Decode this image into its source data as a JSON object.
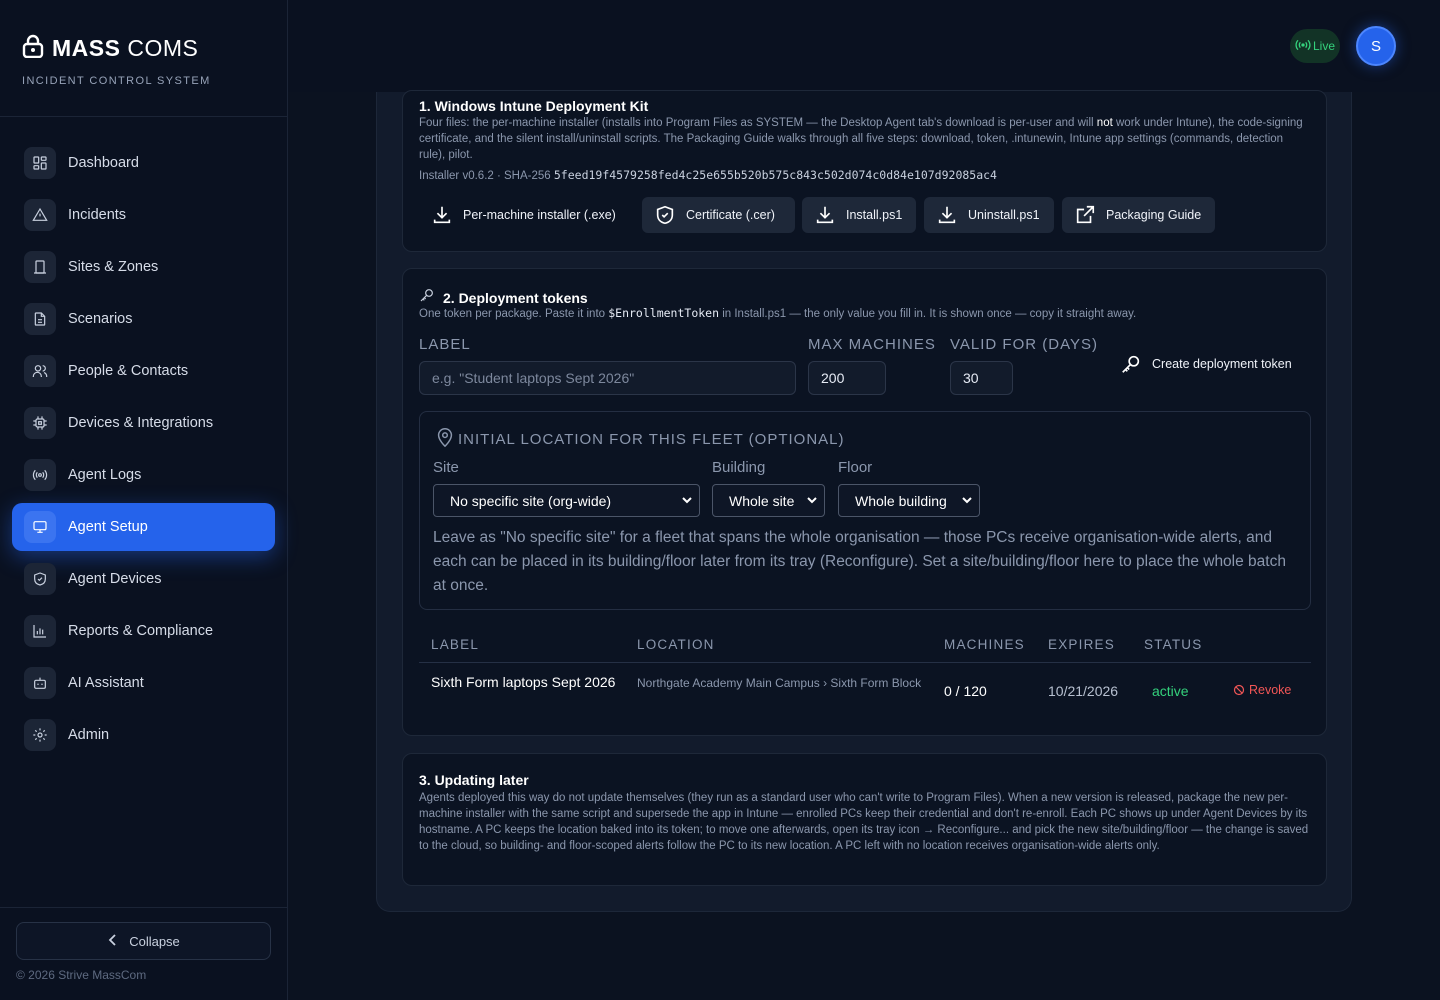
{
  "brand": {
    "name_bold": "MASS",
    "name_light": "COMS",
    "subtitle": "INCIDENT CONTROL SYSTEM"
  },
  "sidebar": {
    "items": [
      {
        "label": "Dashboard",
        "icon": "dashboard-icon"
      },
      {
        "label": "Incidents",
        "icon": "alert-triangle-icon"
      },
      {
        "label": "Sites & Zones",
        "icon": "building-icon"
      },
      {
        "label": "Scenarios",
        "icon": "document-icon"
      },
      {
        "label": "People & Contacts",
        "icon": "users-icon"
      },
      {
        "label": "Devices & Integrations",
        "icon": "chip-icon"
      },
      {
        "label": "Agent Logs",
        "icon": "broadcast-icon"
      },
      {
        "label": "Agent Setup",
        "icon": "monitor-icon",
        "active": true
      },
      {
        "label": "Agent Devices",
        "icon": "shield-icon"
      },
      {
        "label": "Reports & Compliance",
        "icon": "bar-chart-icon"
      },
      {
        "label": "AI Assistant",
        "icon": "bot-icon"
      },
      {
        "label": "Admin",
        "icon": "gear-icon"
      }
    ],
    "collapse_label": "Collapse",
    "copyright": "© 2026 Strive MassCom"
  },
  "topbar": {
    "live_label": "Live",
    "avatar_initial": "S",
    "accent": "#2563eb",
    "live_color": "#34d17c"
  },
  "kit": {
    "title": "1. Windows Intune Deployment Kit",
    "desc_a": "Four files: the per-machine installer (installs into Program Files as SYSTEM — the Desktop Agent tab's download is per-user and will ",
    "desc_bold": "not",
    "desc_b": " work under Intune), the code-signing certificate, and the silent install/uninstall scripts. The Packaging Guide walks through all five steps: download, token, .intunewin, Intune app settings (commands, detection rule), pilot.",
    "installer_meta": "Installer v0.6.2 · SHA-256 ",
    "sha": "5feed19f4579258fed4c25e655b520b575c843c502d074c0d84e107d92085ac4",
    "buttons": {
      "installer": "Per-machine installer (.exe)",
      "certificate": "Certificate (.cer)",
      "install": "Install.ps1",
      "uninstall": "Uninstall.ps1",
      "guide": "Packaging Guide"
    }
  },
  "tokens": {
    "title": "2. Deployment tokens",
    "desc_a": "One token per package. Paste it into ",
    "desc_code": "$EnrollmentToken",
    "desc_b": " in Install.ps1 — the only value you fill in. It is shown once — copy it straight away.",
    "label_heading": "LABEL",
    "label_placeholder": "e.g. \"Student laptops Sept 2026\"",
    "max_heading": "MAX MACHINES",
    "max_value": "200",
    "valid_heading": "VALID FOR (DAYS)",
    "valid_value": "30",
    "create_label": "Create deployment token",
    "fleet": {
      "heading": "INITIAL LOCATION FOR THIS FLEET (OPTIONAL)",
      "site_label": "Site",
      "site_value": "No specific site (org-wide)",
      "building_label": "Building",
      "building_value": "Whole site",
      "floor_label": "Floor",
      "floor_value": "Whole building",
      "help": "Leave as \"No specific site\" for a fleet that spans the whole organisation — those PCs receive organisation-wide alerts, and each can be placed in its building/floor later from its tray (Reconfigure). Set a site/building/floor here to place the whole batch at once."
    },
    "table": {
      "headers": {
        "label": "LABEL",
        "location": "LOCATION",
        "machines": "MACHINES",
        "expires": "EXPIRES",
        "status": "STATUS"
      },
      "rows": [
        {
          "label": "Sixth Form laptops Sept 2026",
          "location": "Northgate Academy Main Campus › Sixth Form Block",
          "machines": "0 / 120",
          "expires": "10/21/2026",
          "status": "active",
          "revoke": "Revoke"
        }
      ]
    }
  },
  "updating": {
    "title": "3. Updating later",
    "desc": "Agents deployed this way do not update themselves (they run as a standard user who can't write to Program Files). When a new version is released, package the new per-machine installer with the same script and supersede the app in Intune — enrolled PCs keep their credential and don't re-enroll. Each PC shows up under Agent Devices by its hostname. A PC keeps the location baked into its token; to move one afterwards, open its tray icon → Reconfigure... and pick the new site/building/floor — the change is saved to the cloud, so building- and floor-scoped alerts follow the PC to its new location. A PC left with no location receives organisation-wide alerts only."
  }
}
